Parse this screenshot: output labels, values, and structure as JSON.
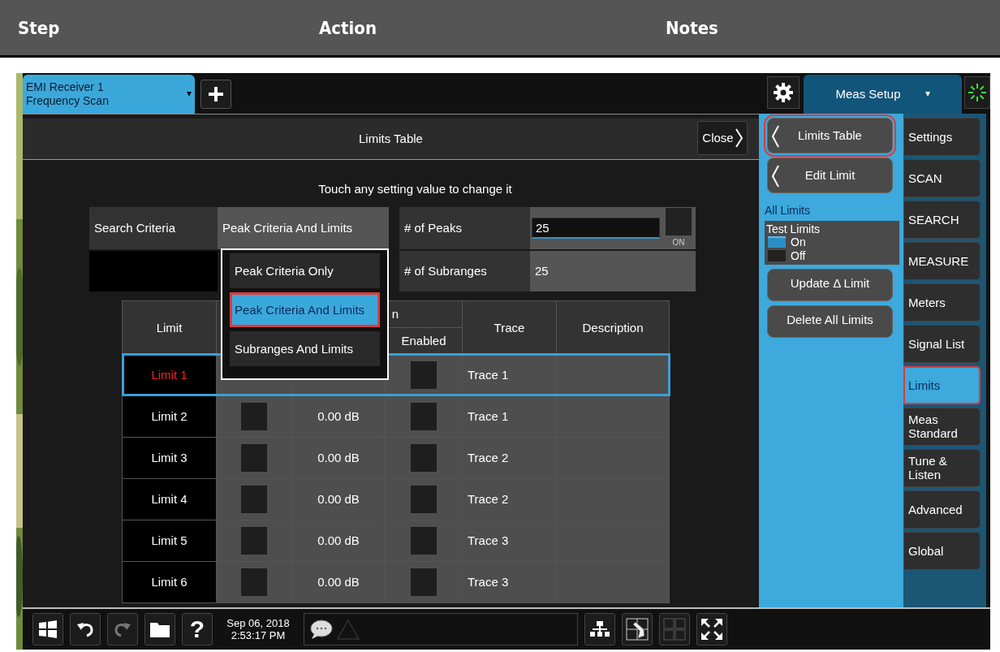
{
  "doc_header": {
    "columns": [
      "Step",
      "Action",
      "Notes"
    ]
  },
  "screen": {
    "measurement_tab": {
      "lines": [
        "EMI Receiver 1",
        "Frequency Scan"
      ],
      "selected": true
    },
    "menu_tab": {
      "label": "Meas Setup"
    },
    "panel": {
      "title": "Limits Table",
      "close": "Close",
      "hint": "Touch any setting value to change it"
    },
    "search_criteria": {
      "label": "Search Criteria",
      "value": "Peak Criteria And Limits"
    },
    "peaks": {
      "label": "# of Peaks",
      "value": "25",
      "editing": true,
      "toggle": "ON"
    },
    "subranges": {
      "label": "# of Subranges",
      "value": "25"
    },
    "dropdown": {
      "options": [
        {
          "label": "Peak Criteria Only",
          "selected": false,
          "highlighted": false
        },
        {
          "label": "Peak Criteria And Limits",
          "selected": true,
          "highlighted": true
        },
        {
          "label": "Subranges And Limits",
          "selected": false,
          "highlighted": false
        }
      ]
    },
    "table": {
      "header": {
        "limit": "Limit",
        "group_fragment": "n",
        "enabled": "Enabled",
        "trace": "Trace",
        "description": "Description"
      },
      "rows": [
        {
          "limit": "Limit 1",
          "selected": true,
          "enabled": false,
          "trace": "Trace 1"
        },
        {
          "limit": "Limit 2",
          "selected": false,
          "checked": false,
          "margin": "0.00 dB",
          "enabled": false,
          "trace": "Trace 1"
        },
        {
          "limit": "Limit 3",
          "selected": false,
          "checked": false,
          "margin": "0.00 dB",
          "enabled": false,
          "trace": "Trace 2"
        },
        {
          "limit": "Limit 4",
          "selected": false,
          "checked": false,
          "margin": "0.00 dB",
          "enabled": false,
          "trace": "Trace 2"
        },
        {
          "limit": "Limit 5",
          "selected": false,
          "checked": false,
          "margin": "0.00 dB",
          "enabled": false,
          "trace": "Trace 3"
        },
        {
          "limit": "Limit 6",
          "selected": false,
          "checked": false,
          "margin": "0.00 dB",
          "enabled": false,
          "trace": "Trace 3"
        }
      ]
    },
    "softkeys": [
      {
        "kind": "back",
        "label": "Limits Table",
        "highlighted": true
      },
      {
        "kind": "back",
        "label": "Edit Limit",
        "highlighted": false
      },
      {
        "kind": "group_label",
        "label": "All Limits"
      },
      {
        "kind": "radio",
        "label": "Test Limits",
        "options": [
          {
            "label": "On",
            "selected": true
          },
          {
            "label": "Off",
            "selected": false
          }
        ]
      },
      {
        "kind": "button",
        "label": "Update Δ Limit"
      },
      {
        "kind": "button",
        "label": "Delete All Limits"
      }
    ],
    "menu_tabs": [
      {
        "label": "Settings",
        "selected": false,
        "highlighted": false
      },
      {
        "label": "SCAN",
        "selected": false,
        "highlighted": false
      },
      {
        "label": "SEARCH",
        "selected": false,
        "highlighted": false
      },
      {
        "label": "MEASURE",
        "selected": false,
        "highlighted": false
      },
      {
        "label": "Meters",
        "selected": false,
        "highlighted": false
      },
      {
        "label": "Signal List",
        "selected": false,
        "highlighted": false
      },
      {
        "label": "Limits",
        "selected": true,
        "highlighted": true
      },
      {
        "label": "Meas Standard",
        "selected": false,
        "highlighted": false
      },
      {
        "label": "Tune & Listen",
        "selected": false,
        "highlighted": false
      },
      {
        "label": "Advanced",
        "selected": false,
        "highlighted": false
      },
      {
        "label": "Global",
        "selected": false,
        "highlighted": false
      }
    ],
    "taskbar": {
      "help": "?",
      "date": "Sep 06, 2018",
      "time": "2:53:17 PM",
      "redo_disabled": true
    }
  }
}
